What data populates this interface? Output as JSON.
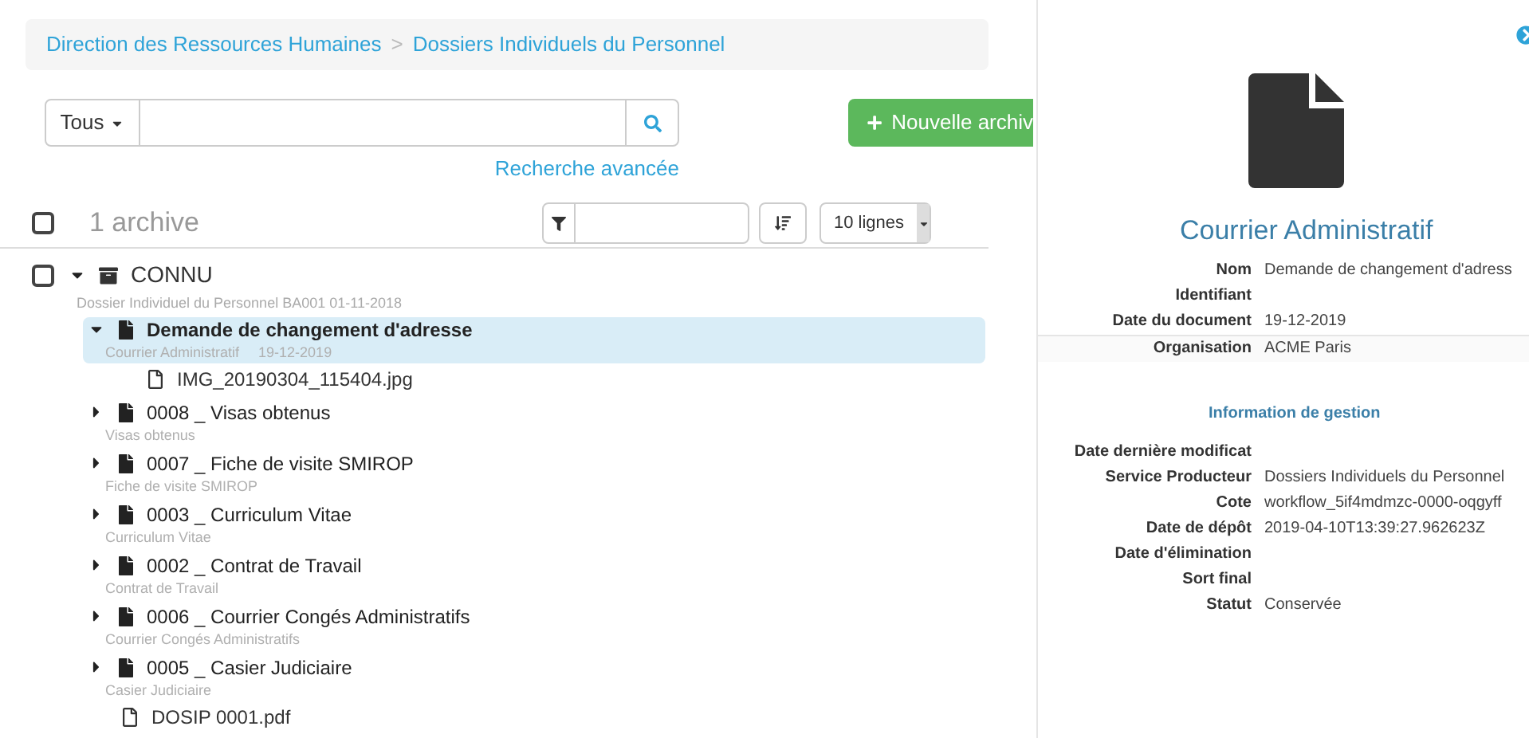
{
  "breadcrumb": [
    {
      "label": "Direction des Ressources Humaines"
    },
    {
      "label": "Dossiers Individuels du Personnel"
    }
  ],
  "breadcrumb_separator": ">",
  "search": {
    "scope": "Tous",
    "advanced_link": "Recherche avancée"
  },
  "new_button": "Nouvelle archiv",
  "list_header": {
    "checked": false,
    "count": "1 archive",
    "page_size": "10 lignes"
  },
  "tree": [
    {
      "kind": "archive",
      "label": "CONNU",
      "checked": false,
      "expanded": true,
      "subtitle": "Dossier Individuel du Personnel BA001 01-11-2018",
      "children": [
        {
          "kind": "document",
          "label": "Demande de changement d'adresse",
          "subtitle": "Courrier Administratif",
          "date": "19-12-2019",
          "expanded": true,
          "selected": true,
          "children": [
            {
              "kind": "file",
              "label": "IMG_20190304_115404.jpg"
            }
          ]
        },
        {
          "kind": "document",
          "label": "0008 _ Visas obtenus",
          "subtitle": "Visas obtenus",
          "expanded": false,
          "selected": false
        },
        {
          "kind": "document",
          "label": "0007 _ Fiche de visite SMIROP",
          "subtitle": "Fiche de visite SMIROP",
          "expanded": false,
          "selected": false
        },
        {
          "kind": "document",
          "label": "0003 _ Curriculum Vitae",
          "subtitle": "Curriculum Vitae",
          "expanded": false,
          "selected": false
        },
        {
          "kind": "document",
          "label": "0002 _ Contrat de Travail",
          "subtitle": "Contrat de Travail",
          "expanded": false,
          "selected": false
        },
        {
          "kind": "document",
          "label": "0006 _ Courrier Congés Administratifs",
          "subtitle": "Courrier Congés Administratifs",
          "expanded": false,
          "selected": false
        },
        {
          "kind": "document",
          "label": "0005 _ Casier Judiciaire",
          "subtitle": "Casier Judiciaire",
          "expanded": false,
          "selected": false
        },
        {
          "kind": "file",
          "label": "DOSIP 0001.pdf"
        }
      ]
    }
  ],
  "detail": {
    "title": "Courrier Administratif",
    "fields": [
      {
        "label": "Nom",
        "value": "Demande de changement d'adress"
      },
      {
        "label": "Identifiant"
      },
      {
        "label": "Date du document",
        "value": "19-12-2019"
      },
      {
        "label": "Organisation",
        "value": "ACME Paris"
      }
    ],
    "management_title": "Information de gestion",
    "management_fields": [
      {
        "label": "Date dernière modificat"
      },
      {
        "label": "Service Producteur",
        "value": "Dossiers Individuels du Personnel"
      },
      {
        "label": "Cote",
        "value": "workflow_5if4mdmzc-0000-oqgyff"
      },
      {
        "label": "Date de dépôt",
        "value": "2019-04-10T13:39:27.962623Z"
      },
      {
        "label": "Date d'élimination"
      },
      {
        "label": "Sort final"
      },
      {
        "label": "Statut",
        "value": "Conservée"
      }
    ]
  }
}
